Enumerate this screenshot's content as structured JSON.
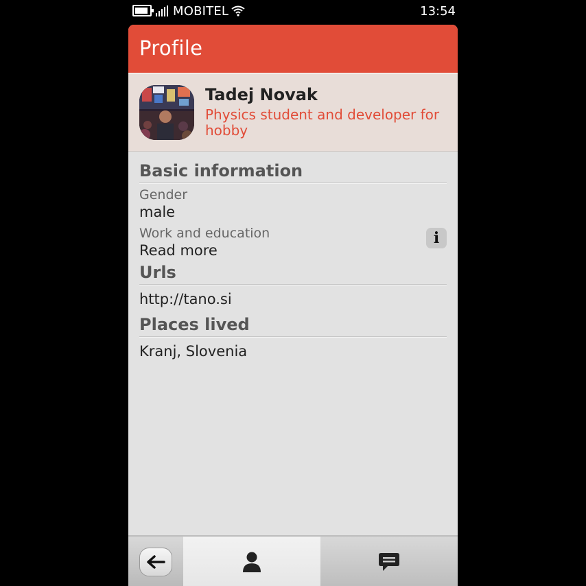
{
  "status_bar": {
    "carrier": "MOBITEL",
    "time": "13:54",
    "icons": [
      "battery-icon",
      "signal-icon",
      "wifi-icon"
    ]
  },
  "header": {
    "title": "Profile",
    "color": "#e14c38"
  },
  "profile": {
    "name": "Tadej Novak",
    "tagline": "Physics student and developer for hobby"
  },
  "sections": {
    "basic": {
      "title": "Basic information",
      "gender_label": "Gender",
      "gender_value": "male",
      "work_label": "Work and education",
      "work_value": "Read more",
      "info_icon": "i"
    },
    "urls": {
      "title": "Urls",
      "value": "http://tano.si"
    },
    "places": {
      "title": "Places lived",
      "value": "Kranj, Slovenia"
    }
  },
  "toolbar": {
    "items": [
      "back-arrow-icon",
      "profile-person-icon",
      "messages-icon"
    ],
    "active": "profile-person-icon"
  }
}
